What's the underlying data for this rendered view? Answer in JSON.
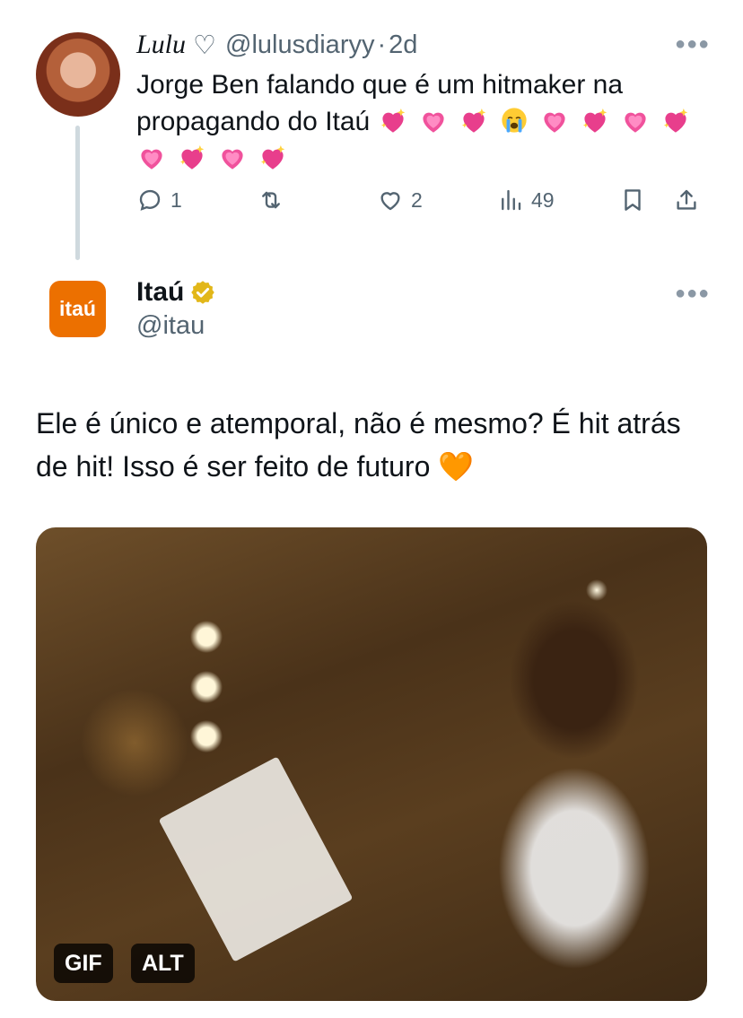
{
  "reply": {
    "name": "Lulu",
    "handle": "@lulusdiaryy",
    "separator": "·",
    "time": "2d",
    "text": "Jorge Ben falando que é um hitmaker na propagando do Itaú",
    "emoji_sequence": [
      "sparkling-heart",
      "heart-pink",
      "sparkling-heart",
      "crying-face",
      "heart-pink",
      "sparkling-heart",
      "heart-pink",
      "sparkling-heart",
      "heart-pink",
      "sparkling-heart",
      "heart-pink",
      "sparkling-heart"
    ],
    "actions": {
      "replies": "1",
      "reposts": "",
      "likes": "2",
      "views": "49"
    }
  },
  "tweet": {
    "name": "Itaú",
    "handle": "@itau",
    "avatar_text": "itaú",
    "text": "Ele é único e atemporal, não é mesmo? É hit atrás de hit! Isso é ser feito de futuro 🧡",
    "media": {
      "badges": [
        "GIF",
        "ALT"
      ]
    }
  },
  "colors": {
    "text": "#0f1419",
    "secondary": "#536471",
    "brand": "#ec7000",
    "verified": "#e2b719",
    "thread_line": "#cfd9de"
  }
}
